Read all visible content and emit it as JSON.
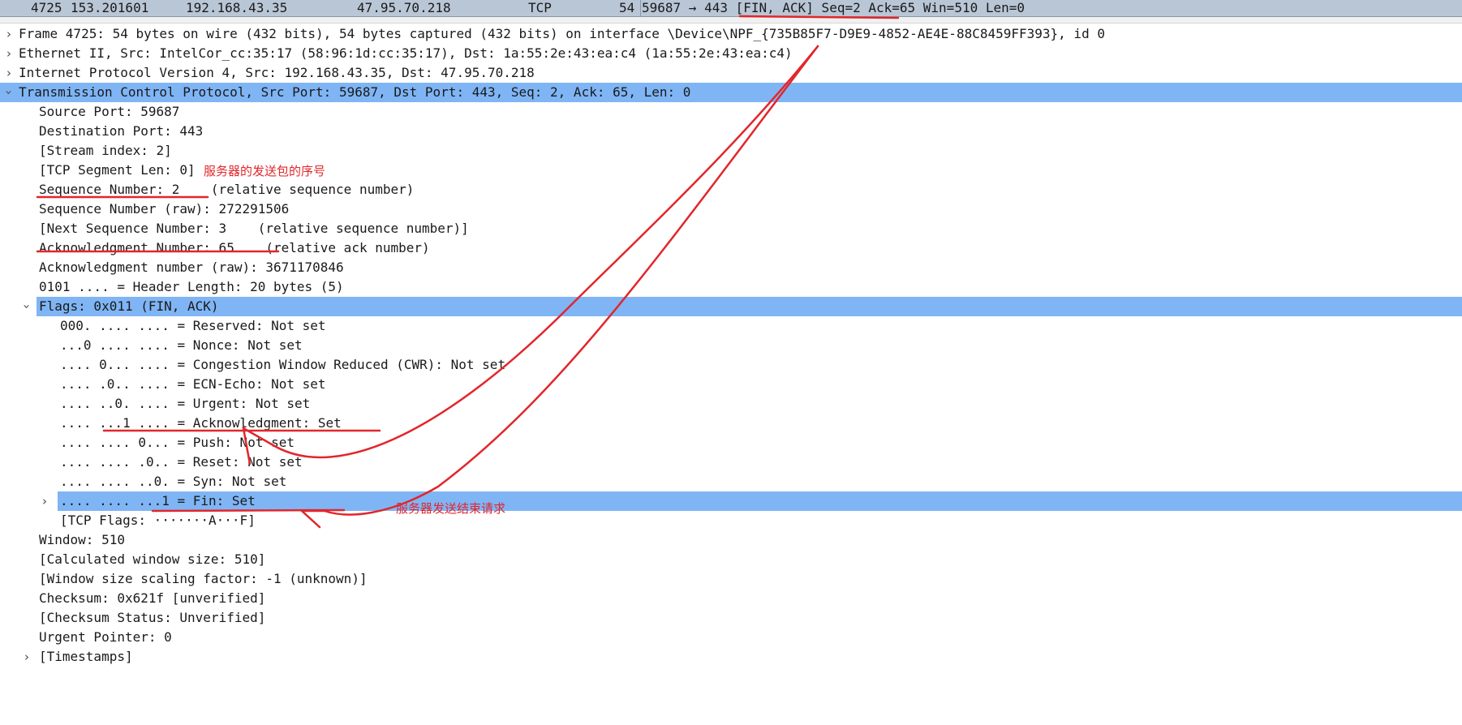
{
  "packet_list": {
    "no": "4725",
    "time": "153.201601",
    "source": "192.168.43.35",
    "destination": "47.95.70.218",
    "protocol": "TCP",
    "length": "54",
    "info": "59687 → 443 [FIN, ACK] Seq=2 Ack=65 Win=510 Len=0"
  },
  "details": {
    "frame": "Frame 4725: 54 bytes on wire (432 bits), 54 bytes captured (432 bits) on interface \\Device\\NPF_{735B85F7-D9E9-4852-AE4E-88C8459FF393}, id 0",
    "ethernet": "Ethernet II, Src: IntelCor_cc:35:17 (58:96:1d:cc:35:17), Dst: 1a:55:2e:43:ea:c4 (1a:55:2e:43:ea:c4)",
    "ip": "Internet Protocol Version 4, Src: 192.168.43.35, Dst: 47.95.70.218",
    "tcp": "Transmission Control Protocol, Src Port: 59687, Dst Port: 443, Seq: 2, Ack: 65, Len: 0",
    "tcp_fields": {
      "source_port": "Source Port: 59687",
      "destination_port": "Destination Port: 443",
      "stream_index": "[Stream index: 2]",
      "segment_len": "[TCP Segment Len: 0]",
      "seq_number": "Sequence Number: 2    (relative sequence number)",
      "seq_raw": "Sequence Number (raw): 272291506",
      "next_seq": "[Next Sequence Number: 3    (relative sequence number)]",
      "ack_number": "Acknowledgment Number: 65    (relative ack number)",
      "ack_raw": "Acknowledgment number (raw): 3671170846",
      "header_length": "0101 .... = Header Length: 20 bytes (5)",
      "flags": "Flags: 0x011 (FIN, ACK)",
      "flag_bits": [
        "000. .... .... = Reserved: Not set",
        "...0 .... .... = Nonce: Not set",
        ".... 0... .... = Congestion Window Reduced (CWR): Not set",
        ".... .0.. .... = ECN-Echo: Not set",
        ".... ..0. .... = Urgent: Not set",
        ".... ...1 .... = Acknowledgment: Set",
        ".... .... 0... = Push: Not set",
        ".... .... .0.. = Reset: Not set",
        ".... .... ..0. = Syn: Not set",
        ".... .... ...1 = Fin: Set"
      ],
      "tcp_flags_str": "[TCP Flags: ·······A···F]",
      "window": "Window: 510",
      "calc_window": "[Calculated window size: 510]",
      "scaling": "[Window size scaling factor: -1 (unknown)]",
      "checksum": "Checksum: 0x621f [unverified]",
      "checksum_status": "[Checksum Status: Unverified]",
      "urgent_pointer": "Urgent Pointer: 0",
      "timestamps": "[Timestamps]"
    }
  },
  "annotations": {
    "seq_note": "服务器的发送包的序号",
    "fin_note": "服务器发送结束请求"
  },
  "colors": {
    "selected_row": "#7fb5f5",
    "packet_row": "#b9c6d6",
    "annotation": "#e2262b"
  }
}
